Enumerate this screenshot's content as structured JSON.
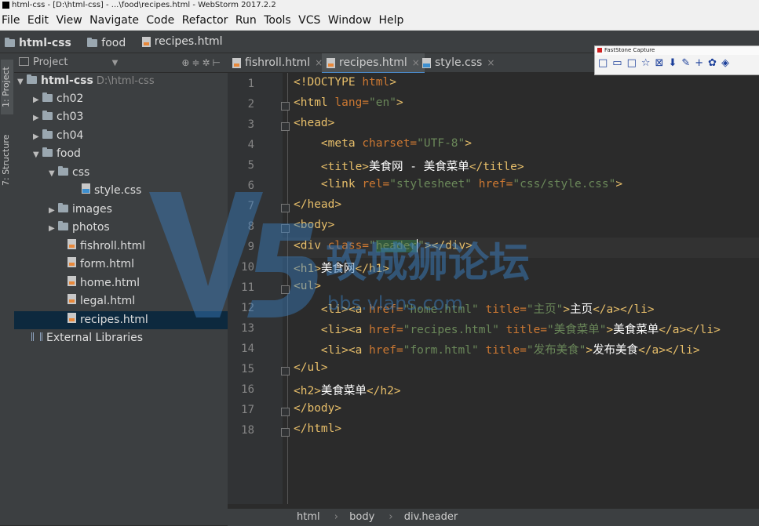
{
  "window": {
    "title": "html-css - [D:\\html-css] - ...\\food\\recipes.html - WebStorm 2017.2.2"
  },
  "menu": [
    "File",
    "Edit",
    "View",
    "Navigate",
    "Code",
    "Refactor",
    "Run",
    "Tools",
    "VCS",
    "Window",
    "Help"
  ],
  "breadcrumb": {
    "root": "html-css",
    "folder": "food",
    "file": "recipes.html"
  },
  "side_tabs": {
    "project": "1: Project",
    "structure": "7: Structure"
  },
  "project": {
    "header": "Project",
    "root": {
      "name": "html-css",
      "path": "D:\\html-css"
    },
    "items": [
      {
        "label": "ch02"
      },
      {
        "label": "ch03"
      },
      {
        "label": "ch04"
      },
      {
        "label": "food"
      },
      {
        "label": "css"
      },
      {
        "label": "style.css"
      },
      {
        "label": "images"
      },
      {
        "label": "photos"
      },
      {
        "label": "fishroll.html"
      },
      {
        "label": "form.html"
      },
      {
        "label": "home.html"
      },
      {
        "label": "legal.html"
      },
      {
        "label": "recipes.html"
      }
    ],
    "external": "External Libraries"
  },
  "tabs": [
    {
      "label": "fishroll.html"
    },
    {
      "label": "recipes.html"
    },
    {
      "label": "style.css"
    }
  ],
  "code": {
    "line_numbers": [
      "1",
      "2",
      "3",
      "4",
      "5",
      "6",
      "7",
      "8",
      "9",
      "10",
      "11",
      "12",
      "13",
      "14",
      "15",
      "16",
      "17",
      "18"
    ]
  },
  "status_crumbs": [
    "html",
    "body",
    "div.header"
  ],
  "faststone": {
    "title": "FastStone Capture"
  },
  "watermark": {
    "text": "玫城狮论坛",
    "url": "bbs.vlans.com"
  }
}
